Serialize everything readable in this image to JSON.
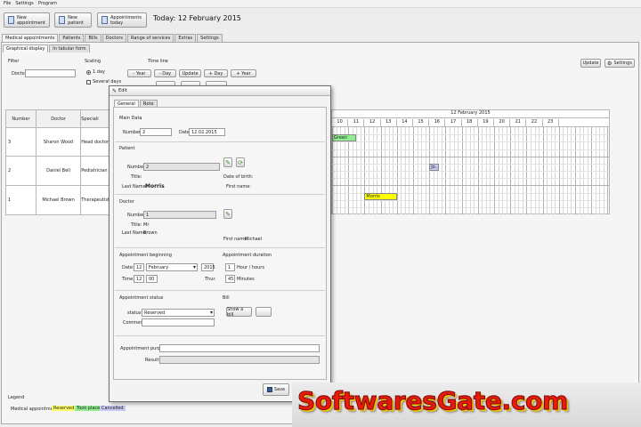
{
  "menu": [
    "File",
    "Settings",
    "Program"
  ],
  "toolbar": {
    "new_appointment": "New appointment",
    "new_patient": "New patient",
    "appointments_today": "Appointments today",
    "today": "Today: 12 February 2015"
  },
  "main_tabs": [
    "Medical appointments",
    "Patients",
    "Bills",
    "Doctors",
    "Range of services",
    "Extras",
    "Settings"
  ],
  "sub_tabs": [
    "Graphical display",
    "In tabular form"
  ],
  "filter": {
    "title": "Filter",
    "doctor_label": "Doctor:"
  },
  "scaling": {
    "title": "Scaling",
    "one_day": "1 day",
    "several_days": "Several days"
  },
  "timeline": {
    "title": "Time line",
    "year_minus": "- Year",
    "day_minus": "- Day",
    "update": "Update",
    "day_plus": "+ Day",
    "year_plus": "+ Year"
  },
  "right_buttons": {
    "update": "Update",
    "settings": "Settings"
  },
  "schedule": {
    "headers": [
      "Number",
      "Doctor",
      "Speciali"
    ],
    "rows": [
      {
        "number": "3",
        "doctor": "Sharon Wood",
        "specialty": "Head doctor"
      },
      {
        "number": "2",
        "doctor": "Daniel Bell",
        "specialty": "Pediatrician"
      },
      {
        "number": "1",
        "doctor": "Michael Brown",
        "specialty": "Therapeutist"
      }
    ],
    "date_header": "12 February 2015",
    "hours": [
      "10",
      "11",
      "12",
      "13",
      "14",
      "15",
      "16",
      "17",
      "18",
      "19",
      "20",
      "21",
      "22",
      "23"
    ],
    "appointments": [
      {
        "label": "Green",
        "row": 0,
        "start_hour": 10.0,
        "end_hour": 11.5,
        "color": "#90ee90"
      },
      {
        "label": "Jo...",
        "row": 1,
        "start_hour": 16.0,
        "end_hour": 16.6,
        "color": "#c8c8f2"
      },
      {
        "label": "Morris",
        "row": 2,
        "start_hour": 12.0,
        "end_hour": 14.0,
        "color": "#ffff00"
      }
    ]
  },
  "legend": {
    "title": "Legend",
    "label": "Medical appointments:",
    "reserved": "Reserved",
    "took_place": "Took place",
    "cancelled": "Cancelled",
    "reserved_color": "#ffff66",
    "took_place_color": "#90ee90",
    "cancelled_color": "#c8c8f2"
  },
  "dialog": {
    "title": "Edit",
    "tabs": [
      "General",
      "Note"
    ],
    "main_data": "Main Data",
    "number_label": "Number:",
    "number_value": "2",
    "date_label": "Date:",
    "date_value": "12.02.2015",
    "patient": {
      "title": "Patient",
      "number_label": "Number:",
      "number_value": "2",
      "title_label": "Title:",
      "dob_label": "Date of birth:",
      "last_name_label": "Last Name:",
      "last_name_value": "Morris",
      "first_name_label": "First name:"
    },
    "doctor": {
      "title": "Doctor",
      "number_label": "Number:",
      "number_value": "1",
      "title_label": "Title:",
      "title_value": "Mr",
      "last_name_label": "Last Name:",
      "last_name_value": "Brown",
      "first_name_label": "First name:",
      "first_name_value": "Michael"
    },
    "beginning": {
      "title": "Appointment beginning",
      "date_label": "Date:",
      "day": "12",
      "month": "February",
      "year": "2015",
      "time_label": "Time:",
      "hour": "12",
      "minute": "00",
      "weekday": "Thur."
    },
    "duration": {
      "title": "Appointment duration",
      "hours_value": "1",
      "hours_label": "Hour / hours",
      "minutes_value": "45",
      "minutes_label": "Minutes"
    },
    "status": {
      "title": "Appointment status",
      "status_label": "status:",
      "status_value": "Reserved",
      "comment_label": "Comment:"
    },
    "bill": {
      "title": "Bill",
      "show_bill": "Show a bill"
    },
    "purpose_label": "Appointment purpose:",
    "result_label": "Result:",
    "save": "Save"
  },
  "watermark": "SoftwaresGate.com"
}
